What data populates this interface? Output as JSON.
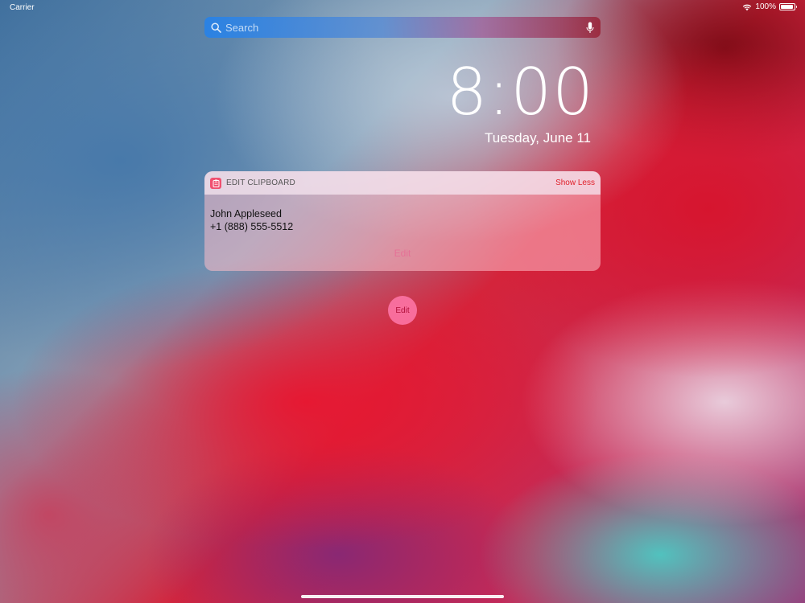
{
  "status_bar": {
    "carrier": "Carrier",
    "battery_percent": "100%",
    "battery_level": 1.0
  },
  "search": {
    "placeholder": "Search"
  },
  "clock": {
    "time": "8:00",
    "date": "Tuesday, June 11"
  },
  "notification": {
    "app_name": "EDIT CLIPBOARD",
    "show_less_label": "Show Less",
    "line1": "John Appleseed",
    "line2": "+1 (888) 555-5512",
    "edit_label": "Edit",
    "accent_color": "#e0202a"
  },
  "floating_action": {
    "label": "Edit"
  },
  "icons": {
    "search": "search-icon",
    "mic": "mic-icon",
    "wifi": "wifi-icon",
    "battery": "battery-icon",
    "app": "clipboard-icon"
  }
}
